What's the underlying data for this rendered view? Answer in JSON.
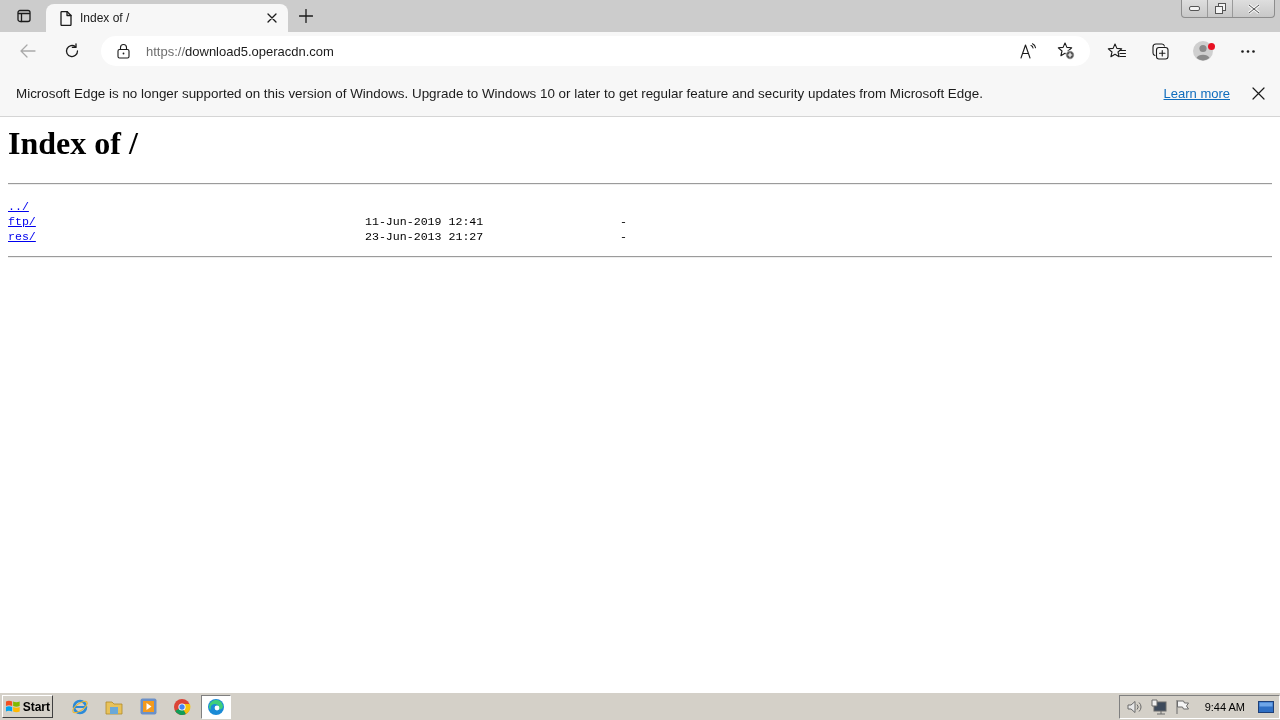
{
  "tabs": [
    {
      "title": "Index of /",
      "selected": true
    }
  ],
  "toolbar": {
    "back": {
      "disabled": true
    },
    "address": {
      "scheme": "https://",
      "host": "download5.operacdn.com"
    },
    "profile": {
      "notification": true
    }
  },
  "infobar": {
    "message": "Microsoft Edge is no longer supported on this version of Windows. Upgrade to Windows 10 or later to get regular feature and security updates from Microsoft Edge.",
    "link": "Learn more"
  },
  "page": {
    "heading": "Index of /",
    "entries": [
      {
        "name": "../"
      },
      {
        "name": "ftp/",
        "date": "11-Jun-2019 12:41",
        "size": "-"
      },
      {
        "name": "res/",
        "date": "23-Jun-2013 21:27",
        "size": "-"
      }
    ]
  },
  "taskbar": {
    "start": "Start",
    "apps": [
      {
        "kind": "ie",
        "selected": false
      },
      {
        "kind": "folder",
        "selected": false
      },
      {
        "kind": "player",
        "selected": false
      },
      {
        "kind": "chrome",
        "selected": false
      },
      {
        "kind": "edge",
        "selected": true
      }
    ],
    "clock": "9:44 AM"
  }
}
